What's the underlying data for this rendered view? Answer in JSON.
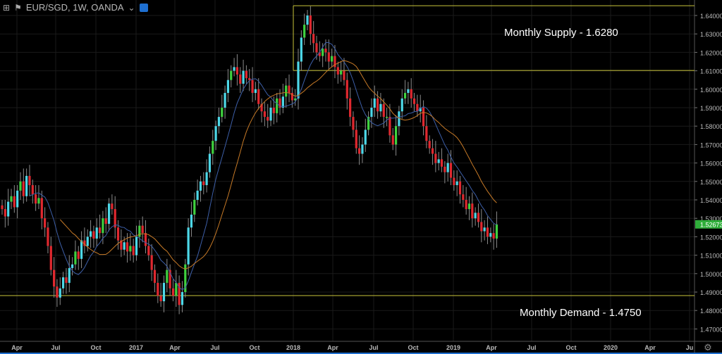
{
  "header": {
    "symbol": "EUR/SGD, 1W, OANDA",
    "add_icon": "plus-square-icon",
    "flag_icon": "flag-icon",
    "settings_icon": "eye-icon"
  },
  "annotations": {
    "supply": "Monthly Supply - 1.6280",
    "demand": "Monthly Demand - 1.4750"
  },
  "colors": {
    "up": "#3fd13f",
    "up_alt": "#4dd8e8",
    "down": "#e0282f",
    "ma_fast": "#3d5fa8",
    "ma_slow": "#c77a27",
    "zone": "#c9c43a",
    "last_price_bg": "#2fae3a"
  },
  "chart_data": {
    "type": "candlestick",
    "title": "EUR/SGD, 1W, OANDA",
    "ylim": [
      1.465,
      1.646
    ],
    "y_ticks": [
      "1.64000",
      "1.63000",
      "1.62000",
      "1.61000",
      "1.60000",
      "1.59000",
      "1.58000",
      "1.57000",
      "1.56000",
      "1.55000",
      "1.54000",
      "1.53000",
      "1.52000",
      "1.51000",
      "1.50000",
      "1.49000",
      "1.48000",
      "1.47000"
    ],
    "x_ticks": [
      "Apr",
      "Jul",
      "Oct",
      "2017",
      "Apr",
      "Jul",
      "Oct",
      "2018",
      "Apr",
      "Jul",
      "Oct",
      "2019",
      "Apr",
      "Jul",
      "Oct",
      "2020",
      "Apr",
      "Ju"
    ],
    "last_price": "1.52673",
    "ma_periods": [
      10,
      20
    ],
    "supply_zone": [
      1.6102,
      1.6453
    ],
    "demand_level": 1.4881,
    "closes": [
      1.535,
      1.531,
      1.539,
      1.542,
      1.536,
      1.545,
      1.55,
      1.542,
      1.553,
      1.548,
      1.543,
      1.538,
      1.541,
      1.53,
      1.525,
      1.515,
      1.502,
      1.493,
      1.487,
      1.492,
      1.498,
      1.495,
      1.503,
      1.505,
      1.512,
      1.508,
      1.518,
      1.515,
      1.52,
      1.523,
      1.519,
      1.525,
      1.522,
      1.53,
      1.527,
      1.538,
      1.535,
      1.525,
      1.518,
      1.513,
      1.517,
      1.512,
      1.515,
      1.51,
      1.52,
      1.526,
      1.522,
      1.515,
      1.51,
      1.502,
      1.495,
      1.488,
      1.485,
      1.495,
      1.502,
      1.492,
      1.488,
      1.495,
      1.483,
      1.49,
      1.505,
      1.525,
      1.532,
      1.54,
      1.545,
      1.55,
      1.548,
      1.555,
      1.565,
      1.572,
      1.58,
      1.585,
      1.59,
      1.598,
      1.605,
      1.61,
      1.612,
      1.608,
      1.603,
      1.61,
      1.606,
      1.605,
      1.598,
      1.6,
      1.592,
      1.588,
      1.585,
      1.583,
      1.59,
      1.587,
      1.595,
      1.59,
      1.596,
      1.602,
      1.598,
      1.594,
      1.595,
      1.615,
      1.628,
      1.635,
      1.64,
      1.63,
      1.625,
      1.62,
      1.618,
      1.622,
      1.62,
      1.615,
      1.618,
      1.612,
      1.608,
      1.61,
      1.605,
      1.595,
      1.585,
      1.578,
      1.568,
      1.565,
      1.57,
      1.578,
      1.585,
      1.59,
      1.595,
      1.588,
      1.592,
      1.585,
      1.585,
      1.575,
      1.57,
      1.58,
      1.588,
      1.595,
      1.598,
      1.6,
      1.595,
      1.592,
      1.588,
      1.59,
      1.58,
      1.572,
      1.568,
      1.565,
      1.56,
      1.562,
      1.558,
      1.555,
      1.56,
      1.552,
      1.548,
      1.55,
      1.543,
      1.54,
      1.535,
      1.538,
      1.53,
      1.533,
      1.528,
      1.523,
      1.525,
      1.52,
      1.522,
      1.519,
      1.5267
    ]
  }
}
